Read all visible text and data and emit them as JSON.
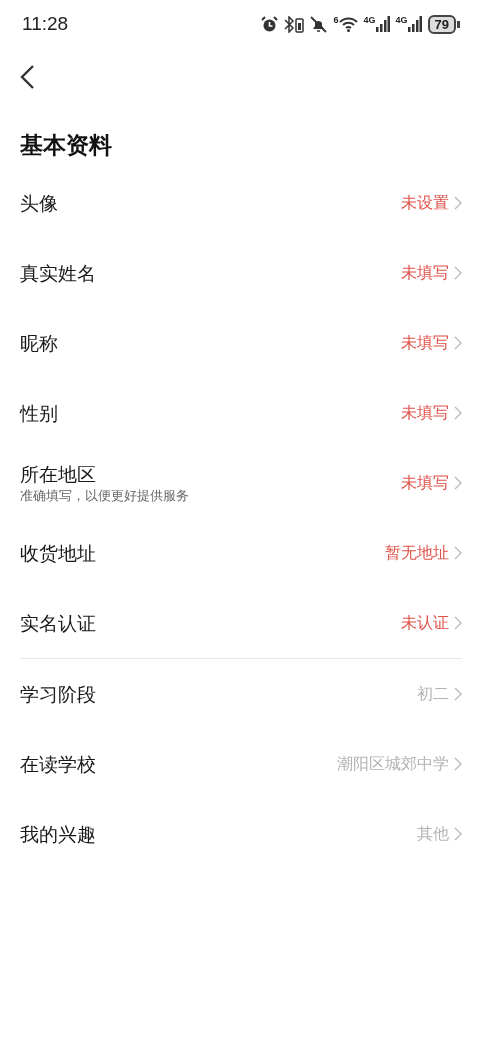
{
  "status_bar": {
    "time": "11:28",
    "wifi_badge": "6",
    "signal_1": "4G",
    "signal_2": "4G",
    "battery": "79"
  },
  "title": "基本资料",
  "sections": [
    {
      "rows": [
        {
          "label": "头像",
          "value": "未设置",
          "filled": false
        },
        {
          "label": "真实姓名",
          "value": "未填写",
          "filled": false
        },
        {
          "label": "昵称",
          "value": "未填写",
          "filled": false
        },
        {
          "label": "性别",
          "value": "未填写",
          "filled": false
        },
        {
          "label": "所在地区",
          "hint": "准确填写，以便更好提供服务",
          "value": "未填写",
          "filled": false
        },
        {
          "label": "收货地址",
          "value": "暂无地址",
          "filled": false
        },
        {
          "label": "实名认证",
          "value": "未认证",
          "filled": false
        }
      ]
    },
    {
      "rows": [
        {
          "label": "学习阶段",
          "value": "初二",
          "filled": true
        },
        {
          "label": "在读学校",
          "value": "潮阳区城郊中学",
          "filled": true
        },
        {
          "label": "我的兴趣",
          "value": "其他",
          "filled": true
        }
      ]
    }
  ]
}
